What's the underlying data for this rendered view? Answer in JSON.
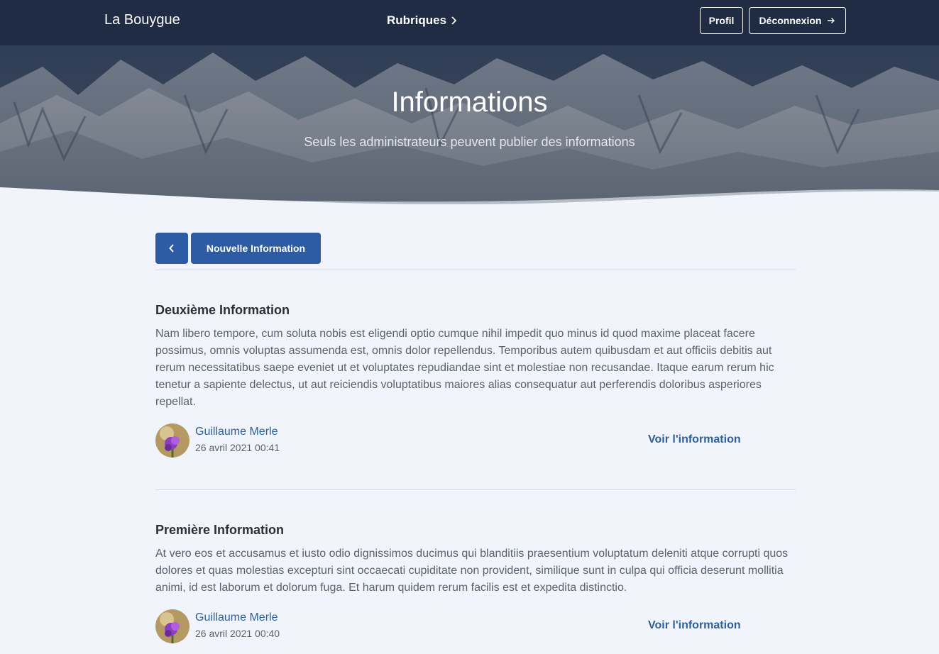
{
  "nav": {
    "brand": "La Bouygue",
    "rubriques": "Rubriques",
    "profil": "Profil",
    "logout": "Déconnexion"
  },
  "hero": {
    "title": "Informations",
    "subtitle": "Seuls les administrateurs peuvent publier des informations"
  },
  "toolbar": {
    "new_label": "Nouvelle Information"
  },
  "posts": [
    {
      "title": "Deuxième Information",
      "body": "Nam libero tempore, cum soluta nobis est eligendi optio cumque nihil impedit quo minus id quod maxime placeat facere possimus, omnis voluptas assumenda est, omnis dolor repellendus. Temporibus autem quibusdam et aut officiis debitis aut rerum necessitatibus saepe eveniet ut et voluptates repudiandae sint et molestiae non recusandae. Itaque earum rerum hic tenetur a sapiente delectus, ut aut reiciendis voluptatibus maiores alias consequatur aut perferendis doloribus asperiores repellat.",
      "author": "Guillaume Merle",
      "date": "26 avril 2021 00:41",
      "link": "Voir l'information"
    },
    {
      "title": "Première Information",
      "body": "At vero eos et accusamus et iusto odio dignissimos ducimus qui blanditiis praesentium voluptatum deleniti atque corrupti quos dolores et quas molestias excepturi sint occaecati cupiditate non provident, similique sunt in culpa qui officia deserunt mollitia animi, id est laborum et dolorum fuga. Et harum quidem rerum facilis est et expedita distinctio.",
      "author": "Guillaume Merle",
      "date": "26 avril 2021 00:40",
      "link": "Voir l'information"
    }
  ],
  "colors": {
    "nav_bg": "#1f2c43",
    "accent": "#2d5ca5",
    "link": "#2e5f97",
    "page_bg": "#f1f4fb"
  },
  "icons": {
    "rubriques": "chevron-right-icon",
    "logout": "arrow-right-icon",
    "back": "chevron-left-icon"
  }
}
